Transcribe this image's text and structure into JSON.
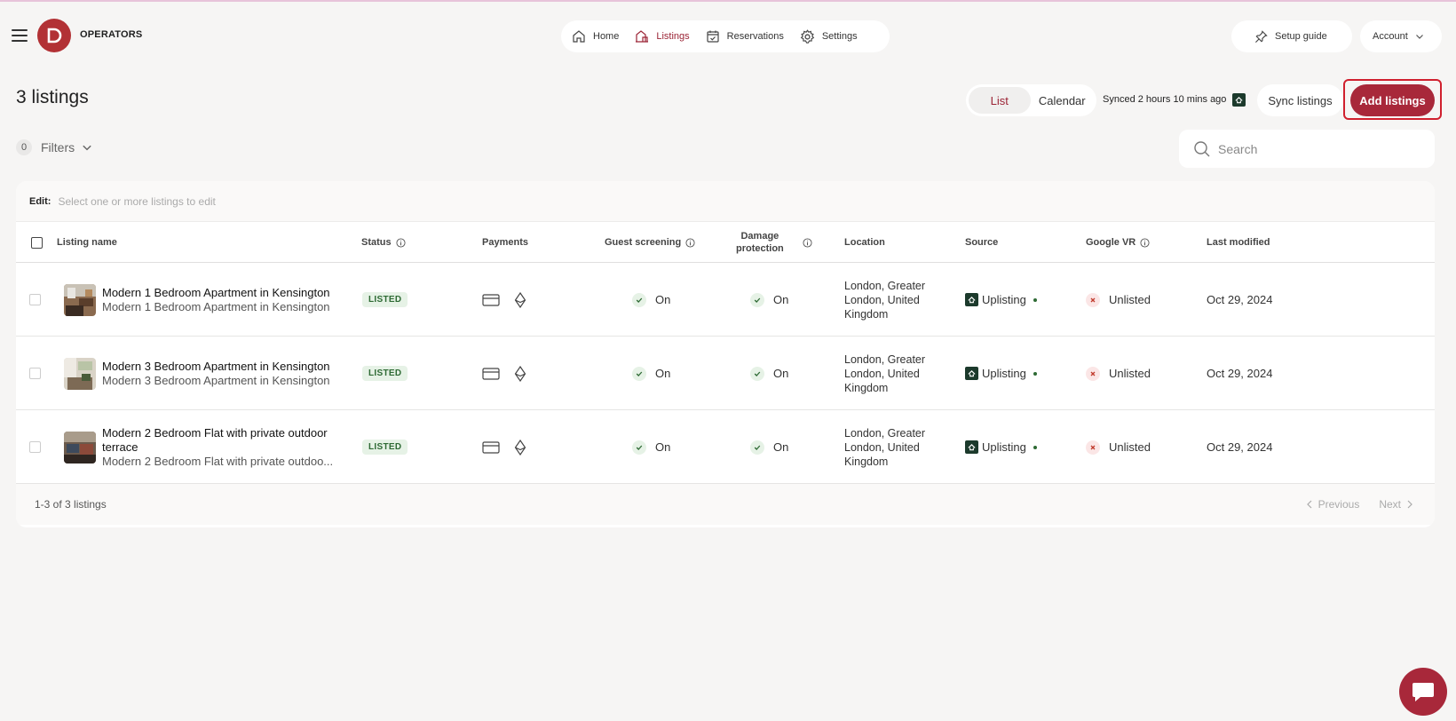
{
  "header": {
    "brand": "OPERATORS",
    "logo_letter": "D",
    "nav": [
      {
        "label": "Home",
        "icon": "home-icon",
        "active": false
      },
      {
        "label": "Listings",
        "icon": "listings-icon",
        "active": true
      },
      {
        "label": "Reservations",
        "icon": "calendar-check-icon",
        "active": false
      },
      {
        "label": "Settings",
        "icon": "gear-icon",
        "active": false
      }
    ],
    "setup_guide": "Setup guide",
    "account": "Account"
  },
  "toolbar": {
    "title": "3 listings",
    "view_list": "List",
    "view_calendar": "Calendar",
    "synced": "Synced 2 hours 10 mins ago",
    "sync_button": "Sync listings",
    "add_button": "Add listings",
    "filter_count": "0",
    "filters_label": "Filters",
    "search_placeholder": "Search"
  },
  "edit_bar": {
    "label": "Edit:",
    "hint": "Select one or more listings to edit"
  },
  "table": {
    "columns": {
      "name": "Listing name",
      "status": "Status",
      "payments": "Payments",
      "screening": "Guest screening",
      "damage_1": "Damage",
      "damage_2": "protection",
      "location": "Location",
      "source": "Source",
      "google": "Google VR",
      "modified": "Last modified"
    },
    "rows": [
      {
        "title": "Modern 1 Bedroom Apartment in Kensington",
        "subtitle": "Modern 1 Bedroom Apartment in Kensington",
        "status": "LISTED",
        "screening": "On",
        "damage": "On",
        "location": "London, Greater London, United Kingdom",
        "source": "Uplisting",
        "google": "Unlisted",
        "modified": "Oct 29, 2024"
      },
      {
        "title": "Modern 3 Bedroom Apartment in Kensington",
        "subtitle": "Modern 3 Bedroom Apartment in Kensington",
        "status": "LISTED",
        "screening": "On",
        "damage": "On",
        "location": "London, Greater London, United Kingdom",
        "source": "Uplisting",
        "google": "Unlisted",
        "modified": "Oct 29, 2024"
      },
      {
        "title": "Modern 2 Bedroom Flat with private outdoor terrace",
        "subtitle": "Modern 2 Bedroom Flat with private outdoo...",
        "status": "LISTED",
        "screening": "On",
        "damage": "On",
        "location": "London, Greater London, United Kingdom",
        "source": "Uplisting",
        "google": "Unlisted",
        "modified": "Oct 29, 2024"
      }
    ]
  },
  "footer": {
    "range": "1-3 of 3 listings",
    "previous": "Previous",
    "next": "Next"
  },
  "colors": {
    "brand": "#b23135",
    "accent": "#a8283a",
    "active_nav": "#9b2335",
    "listed_green": "#2e6a34",
    "source_green": "#1c3a2c"
  }
}
